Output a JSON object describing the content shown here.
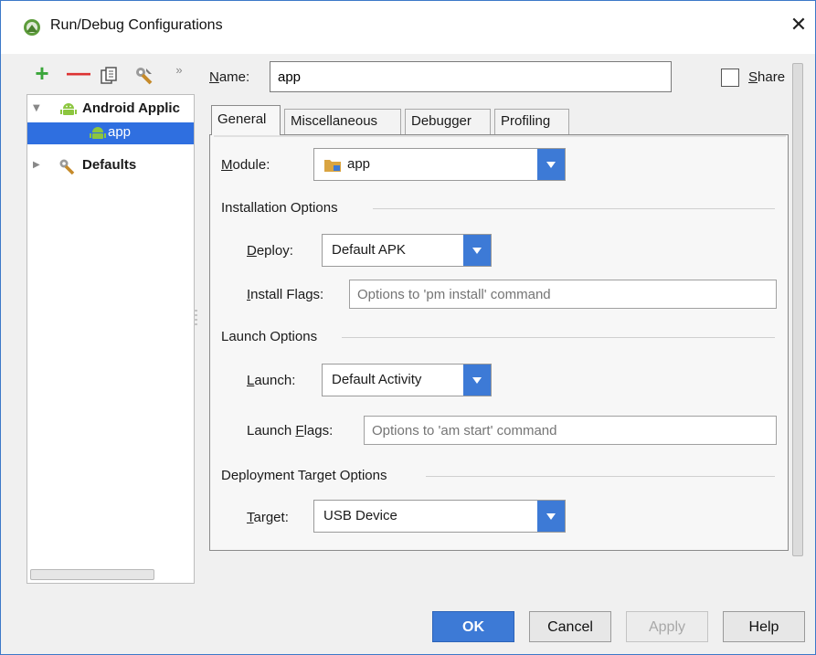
{
  "window": {
    "title": "Run/Debug Configurations",
    "close": "✕"
  },
  "toolbar": {
    "add": "+",
    "remove": "—",
    "more": "»"
  },
  "tree": {
    "items": [
      {
        "label": "Android Applic",
        "expanded": true
      },
      {
        "label": "app",
        "selected": true
      },
      {
        "label": "Defaults",
        "expanded": false
      }
    ]
  },
  "name": {
    "label_pre": "",
    "label_mnemonic": "N",
    "label_post": "ame:",
    "value": "app"
  },
  "share": {
    "label_mnemonic": "S",
    "label_post": "hare",
    "checked": false
  },
  "tabs": [
    "General",
    "Miscellaneous",
    "Debugger",
    "Profiling"
  ],
  "general": {
    "module": {
      "label_mnemonic": "M",
      "label_post": "odule:",
      "value": "app"
    },
    "installation": {
      "title": "Installation Options",
      "deploy": {
        "label_mnemonic": "D",
        "label_post": "eploy:",
        "value": "Default APK"
      },
      "install_flags": {
        "label_mnemonic": "I",
        "label_post": "nstall Flags:",
        "placeholder": "Options to 'pm install' command"
      }
    },
    "launch": {
      "title": "Launch Options",
      "launch": {
        "label_mnemonic": "L",
        "label_post": "aunch:",
        "value": "Default Activity"
      },
      "launch_flags": {
        "label_pre": "Launch ",
        "label_mnemonic": "F",
        "label_post": "lags:",
        "placeholder": "Options to 'am start' command"
      }
    },
    "deployment": {
      "title": "Deployment Target Options",
      "target": {
        "label_mnemonic": "T",
        "label_post": "arget:",
        "value": "USB Device"
      }
    }
  },
  "buttons": {
    "ok": "OK",
    "cancel": "Cancel",
    "apply": "Apply",
    "help": "Help"
  },
  "colors": {
    "accent": "#3d7ad6",
    "selection": "#2f6fe0",
    "android_green": "#8cc63f"
  }
}
